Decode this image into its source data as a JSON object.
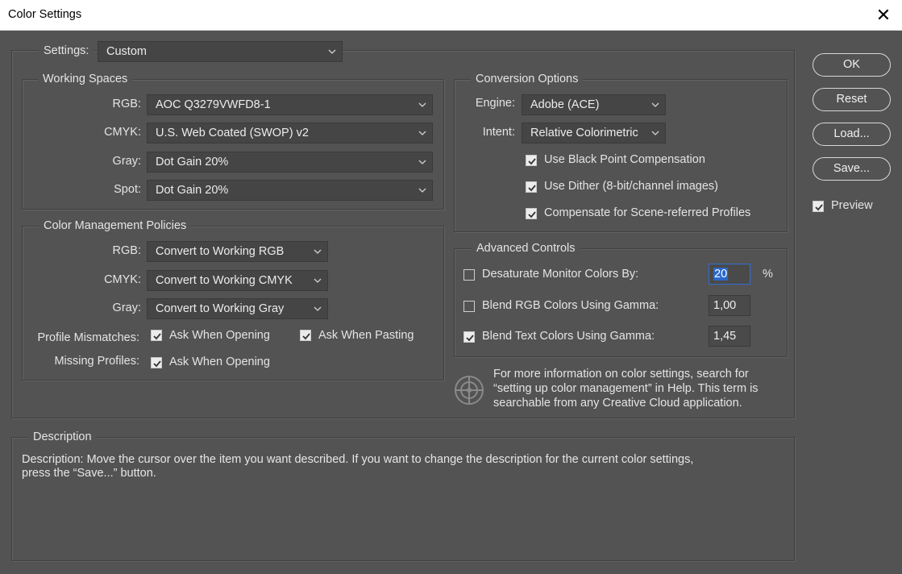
{
  "window": {
    "title": "Color Settings",
    "close_glyph": "✕"
  },
  "settings": {
    "label": "Settings:",
    "value": "Custom"
  },
  "working_spaces": {
    "title": "Working Spaces",
    "rows": [
      {
        "label": "RGB:",
        "value": "AOC Q3279VWFD8-1"
      },
      {
        "label": "CMYK:",
        "value": "U.S. Web Coated (SWOP) v2"
      },
      {
        "label": "Gray:",
        "value": "Dot Gain 20%"
      },
      {
        "label": "Spot:",
        "value": "Dot Gain 20%"
      }
    ]
  },
  "policies": {
    "title": "Color Management Policies",
    "rows": [
      {
        "label": "RGB:",
        "value": "Convert to Working RGB"
      },
      {
        "label": "CMYK:",
        "value": "Convert to Working CMYK"
      },
      {
        "label": "Gray:",
        "value": "Convert to Working Gray"
      }
    ],
    "profile_mismatches": {
      "label": "Profile Mismatches:",
      "ask_opening": "Ask When Opening",
      "ask_pasting": "Ask When Pasting"
    },
    "missing_profiles": {
      "label": "Missing Profiles:",
      "ask_opening": "Ask When Opening"
    }
  },
  "conversion": {
    "title": "Conversion Options",
    "engine_label": "Engine:",
    "engine_value": "Adobe (ACE)",
    "intent_label": "Intent:",
    "intent_value": "Relative Colorimetric",
    "bpc": "Use Black Point Compensation",
    "dither": "Use Dither (8-bit/channel images)",
    "scene": "Compensate for Scene-referred Profiles"
  },
  "advanced": {
    "title": "Advanced Controls",
    "desaturate": {
      "label": "Desaturate Monitor Colors By:",
      "value": "20",
      "unit": "%",
      "checked": false
    },
    "blend_rgb": {
      "label": "Blend RGB Colors Using Gamma:",
      "value": "1,00",
      "checked": false
    },
    "blend_text": {
      "label": "Blend Text Colors Using Gamma:",
      "value": "1,45",
      "checked": true
    }
  },
  "info": {
    "line1": "For more information on color settings, search for",
    "line2": "“setting up color management” in Help. This term is",
    "line3": "searchable from any Creative Cloud application."
  },
  "description": {
    "title": "Description",
    "line1": "Description:  Move the cursor over the item you want described.  If you want to change the description for the current color settings,",
    "line2": "press the “Save...” button."
  },
  "buttons": {
    "ok": "OK",
    "reset": "Reset",
    "load": "Load...",
    "save": "Save...",
    "preview": "Preview"
  },
  "icons": [
    "close-icon",
    "chevron-down-icon",
    "checkmark-icon",
    "color-wheel-icon"
  ]
}
